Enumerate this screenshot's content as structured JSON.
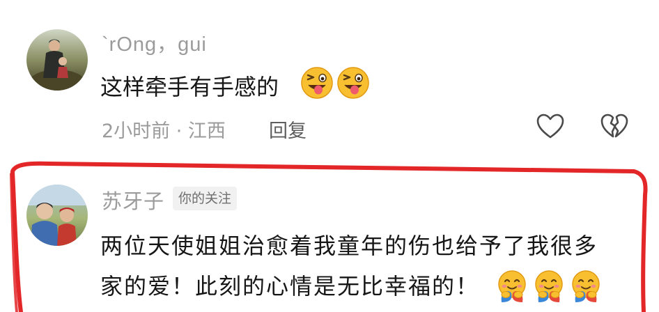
{
  "comments": [
    {
      "username": "`rOng，gui",
      "text": "这样牵手有手感的",
      "emojis": [
        "winking-face-with-tongue",
        "winking-face-with-tongue"
      ],
      "meta": "2小时前 · 江西",
      "reply_label": "回复"
    },
    {
      "username": "苏牙子",
      "badge": "你的关注",
      "text_line1": "两位天使姐姐治愈着我童年的伤也给予了我很多",
      "text_line2": "家的爱！此刻的心情是无比幸福的！",
      "emojis": [
        "hugging-face",
        "hugging-face",
        "hugging-face"
      ]
    }
  ],
  "icons": {
    "like": "heart-outline-icon",
    "dislike": "broken-heart-icon"
  },
  "colors": {
    "highlight": "#e32628",
    "username": "#9b9b9b",
    "text": "#161616",
    "badge_bg": "#f1f1f1"
  }
}
